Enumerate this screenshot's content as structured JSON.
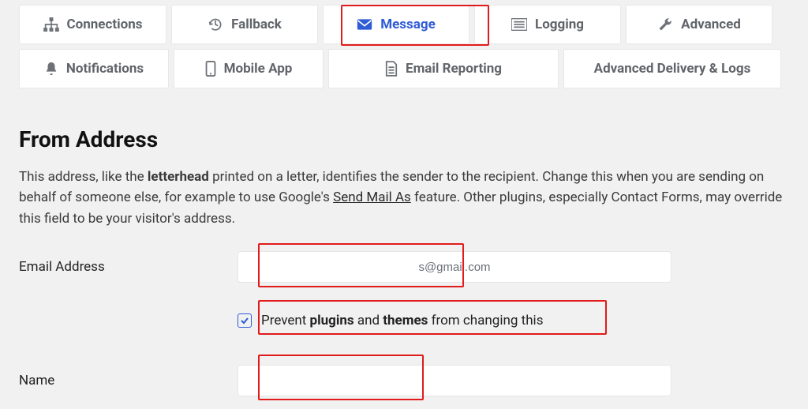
{
  "tabs": {
    "row1": [
      {
        "label": "Connections",
        "icon": "sitemap-icon",
        "active": false
      },
      {
        "label": "Fallback",
        "icon": "history-icon",
        "active": false
      },
      {
        "label": "Message",
        "icon": "envelope-icon",
        "active": true
      },
      {
        "label": "Logging",
        "icon": "list-icon",
        "active": false
      },
      {
        "label": "Advanced",
        "icon": "wrench-icon",
        "active": false
      }
    ],
    "row2": [
      {
        "label": "Notifications",
        "icon": "bell-icon",
        "active": false
      },
      {
        "label": "Mobile App",
        "icon": "mobile-icon",
        "active": false
      },
      {
        "label": "Email Reporting",
        "icon": "doc-icon",
        "active": false
      },
      {
        "label": "Advanced Delivery & Logs",
        "icon": "",
        "active": false
      }
    ]
  },
  "section": {
    "heading": "From Address",
    "desc_1a": "This address, like the ",
    "desc_1b_bold": "letterhead",
    "desc_1c": " printed on a letter, identifies the sender to the recipient. Change this when you are sending on behalf of someone else, for example to use Google's ",
    "desc_link": "Send Mail As",
    "desc_1d": " feature. Other plugins, especially Contact Forms, may override this field to be your visitor's address."
  },
  "fields": {
    "email": {
      "label": "Email Address",
      "value": "s@gmail.com"
    },
    "prevent": {
      "checked": true,
      "label_1": "Prevent ",
      "label_b1": "plugins",
      "label_2": " and ",
      "label_b2": "themes",
      "label_3": " from changing this"
    },
    "name": {
      "label": "Name",
      "value": ""
    }
  }
}
